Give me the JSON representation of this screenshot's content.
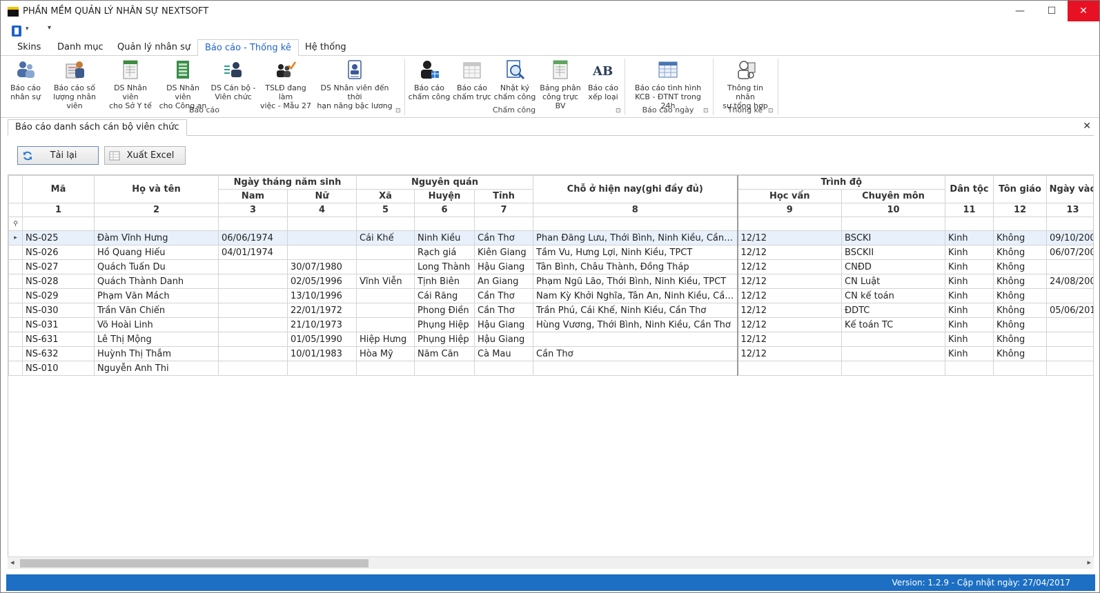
{
  "window": {
    "title": "PHẦN MỀM QUẢN LÝ NHÂN SỰ NEXTSOFT",
    "min": "—",
    "max": "☐",
    "close": "✕"
  },
  "qat": {
    "drop": "▾",
    "customize": "▾"
  },
  "tabs": [
    {
      "label": "Skins"
    },
    {
      "label": "Danh mục"
    },
    {
      "label": "Quản lý nhân sự"
    },
    {
      "label": "Báo cáo - Thống kê"
    },
    {
      "label": "Hệ thống"
    }
  ],
  "ribbon": {
    "groups": [
      {
        "label": "Báo cáo"
      },
      {
        "label": "Chấm công"
      },
      {
        "label": "Báo cáo ngày"
      },
      {
        "label": "Thống kê"
      }
    ],
    "buttons": [
      {
        "line1": "Báo cáo",
        "line2": "nhân sự",
        "icon": "users-report-icon"
      },
      {
        "line1": "Báo cáo số",
        "line2": "lượng nhân viên",
        "icon": "staff-count-icon"
      },
      {
        "line1": "DS Nhân viên",
        "line2": "cho Sở Y tế",
        "icon": "sheet-icon"
      },
      {
        "line1": "DS Nhân viên",
        "line2": "cho Công an",
        "icon": "green-sheet-icon"
      },
      {
        "line1": "DS Cán bộ -",
        "line2": "Viên chức",
        "icon": "officer-list-icon"
      },
      {
        "line1": "TSLĐ đang làm",
        "line2": "việc - Mẫu 27",
        "icon": "workers-check-icon"
      },
      {
        "line1": "DS Nhân viên đến thời",
        "line2": "hạn nâng bậc lương",
        "icon": "id-card-icon"
      },
      {
        "line1": "Báo cáo",
        "line2": "chấm công",
        "icon": "attendance-icon"
      },
      {
        "line1": "Báo cáo",
        "line2": "chấm trực",
        "icon": "calendar-icon"
      },
      {
        "line1": "Nhật ký",
        "line2": "chấm công",
        "icon": "magnifier-doc-icon"
      },
      {
        "line1": "Bảng phân",
        "line2": "công trực BV",
        "icon": "duty-sheet-icon"
      },
      {
        "line1": "Báo cáo",
        "line2": "xếp loại",
        "icon": "ab-icon"
      },
      {
        "line1": "Báo cáo tình hình",
        "line2": "KCB - ĐTNT trong 24h",
        "icon": "table-icon"
      },
      {
        "line1": "Thông tin nhân",
        "line2": "sự tổng hợp",
        "icon": "doctor-icon"
      }
    ],
    "launcher": "⊡"
  },
  "doc": {
    "tab_label": "Báo cáo danh sách cán bộ viên chức",
    "close": "✕"
  },
  "toolbar": {
    "reload_label": "Tải lại",
    "export_label": "Xuất Excel"
  },
  "grid": {
    "headers": {
      "ma": "Mã",
      "hoten": "Họ và tên",
      "ngaysinh": "Ngày tháng năm sinh",
      "nam": "Nam",
      "nu": "Nữ",
      "nguyenquan": "Nguyên quán",
      "xa": "Xã",
      "huyen": "Huyện",
      "tinh": "Tỉnh",
      "choo": "Chỗ ở hiện nay(ghi đầy đủ)",
      "trinhdo": "Trình độ",
      "hocvan": "Học vấn",
      "chuyenmon": "Chuyên môn",
      "dantoc": "Dân tộc",
      "tongiao": "Tôn giáo",
      "ngayvao": "Ngày vào"
    },
    "col_numbers": [
      "1",
      "2",
      "3",
      "4",
      "5",
      "6",
      "7",
      "8",
      "9",
      "10",
      "11",
      "12",
      "13"
    ],
    "filter_icon": "⚲",
    "row_indicator": "▸",
    "rows": [
      {
        "ma": "NS-025",
        "ten": "Đàm Vĩnh Hưng",
        "nam": "06/06/1974",
        "nu": "",
        "xa": "Cái Khế",
        "huyen": "Ninh Kiều",
        "tinh": "Cần Thơ",
        "choo": "Phan Đăng Lưu, Thới Bình, Ninh Kiều, Cần Thơ",
        "hocvan": "12/12",
        "chuyenmon": "BSCKI",
        "dantoc": "Kinh",
        "tongiao": "Không",
        "ngayvao": "09/10/200"
      },
      {
        "ma": "NS-026",
        "ten": "Hồ Quang Hiếu",
        "nam": "04/01/1974",
        "nu": "",
        "xa": "",
        "huyen": "Rạch giá",
        "tinh": "Kiên Giang",
        "choo": "Tầm Vu, Hưng Lợi, Ninh Kiều, TPCT",
        "hocvan": "12/12",
        "chuyenmon": "BSCKII",
        "dantoc": "Kinh",
        "tongiao": "Không",
        "ngayvao": "06/07/200"
      },
      {
        "ma": "NS-027",
        "ten": "Quách Tuấn Du",
        "nam": "",
        "nu": "30/07/1980",
        "xa": "",
        "huyen": "Long Thành",
        "tinh": "Hậu Giang",
        "choo": "Tân Bình, Châu Thành, Đồng Tháp",
        "hocvan": "12/12",
        "chuyenmon": "CNĐD",
        "dantoc": "Kinh",
        "tongiao": "Không",
        "ngayvao": ""
      },
      {
        "ma": "NS-028",
        "ten": "Quách Thành Danh",
        "nam": "",
        "nu": "02/05/1996",
        "xa": "Vĩnh Viễn",
        "huyen": "Tịnh Biên",
        "tinh": "An Giang",
        "choo": "Phạm Ngũ Lão, Thới Bình, Ninh Kiều, TPCT",
        "hocvan": "12/12",
        "chuyenmon": "CN Luật",
        "dantoc": "Kinh",
        "tongiao": "Không",
        "ngayvao": "24/08/200"
      },
      {
        "ma": "NS-029",
        "ten": "Phạm Văn Mách",
        "nam": "",
        "nu": "13/10/1996",
        "xa": "",
        "huyen": "Cái Răng",
        "tinh": "Cần Thơ",
        "choo": "Nam Kỳ Khởi Nghĩa, Tân An, Ninh Kiều, Cần ...",
        "hocvan": "12/12",
        "chuyenmon": "CN kế toán",
        "dantoc": "Kinh",
        "tongiao": "Không",
        "ngayvao": ""
      },
      {
        "ma": "NS-030",
        "ten": "Trần Văn Chiến",
        "nam": "",
        "nu": "22/01/1972",
        "xa": "",
        "huyen": "Phong Điền",
        "tinh": "Cần Thơ",
        "choo": "Trần Phú, Cái Khế, Ninh Kiều, Cần Thơ",
        "hocvan": "12/12",
        "chuyenmon": "ĐDTC",
        "dantoc": "Kinh",
        "tongiao": "Không",
        "ngayvao": "05/06/201"
      },
      {
        "ma": "NS-031",
        "ten": "Võ Hoài Linh",
        "nam": "",
        "nu": "21/10/1973",
        "xa": "",
        "huyen": "Phụng Hiệp",
        "tinh": "Hậu Giang",
        "choo": "Hùng Vương, Thới Bình, Ninh Kiều, Cần Thơ",
        "hocvan": "12/12",
        "chuyenmon": "Kế toán TC",
        "dantoc": "Kinh",
        "tongiao": "Không",
        "ngayvao": ""
      },
      {
        "ma": "NS-631",
        "ten": "Lê Thị Mộng",
        "nam": "",
        "nu": "01/05/1990",
        "xa": "Hiệp Hưng",
        "huyen": "Phụng Hiệp",
        "tinh": "Hậu Giang",
        "choo": "",
        "hocvan": "12/12",
        "chuyenmon": "",
        "dantoc": "Kinh",
        "tongiao": "Không",
        "ngayvao": ""
      },
      {
        "ma": "NS-632",
        "ten": "Huỳnh Thị Thắm",
        "nam": "",
        "nu": "10/01/1983",
        "xa": "Hòa Mỹ",
        "huyen": "Năm Căn",
        "tinh": "Cà Mau",
        "choo": "Cần Thơ",
        "hocvan": "12/12",
        "chuyenmon": "",
        "dantoc": "Kinh",
        "tongiao": "Không",
        "ngayvao": ""
      },
      {
        "ma": "NS-010",
        "ten": "Nguyễn Anh Thi",
        "nam": "",
        "nu": "",
        "xa": "",
        "huyen": "",
        "tinh": "",
        "choo": "",
        "hocvan": "",
        "chuyenmon": "",
        "dantoc": "",
        "tongiao": "",
        "ngayvao": ""
      }
    ]
  },
  "scroll": {
    "left": "◂",
    "right": "▸"
  },
  "status": {
    "text": "Version: 1.2.9 - Cập nhật ngày: 27/04/2017"
  }
}
